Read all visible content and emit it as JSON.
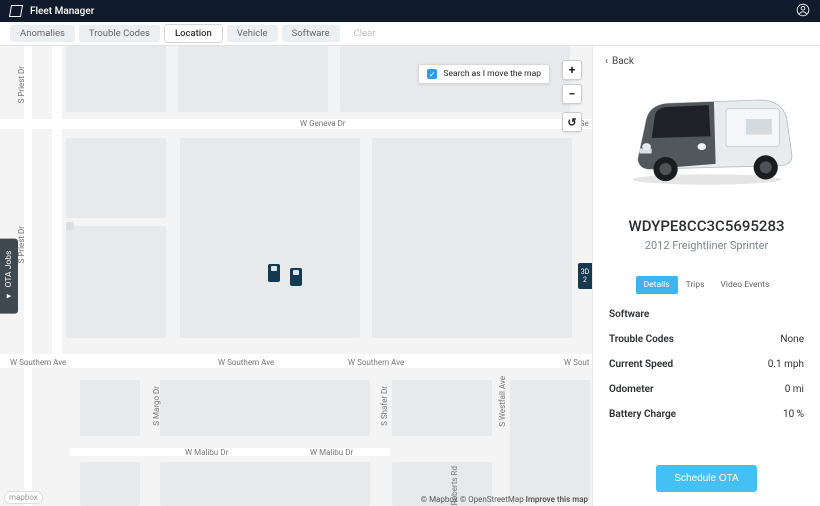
{
  "header": {
    "app_title": "Fleet Manager"
  },
  "tabs": {
    "items": [
      "Anomalies",
      "Trouble Codes",
      "Location",
      "Vehicle",
      "Software"
    ],
    "clear": "Clear"
  },
  "map": {
    "search_checkbox_label": "Search as I move the map",
    "ota_jobs_label": "OTA Jobs",
    "attribution_mapbox": "© Mapbox",
    "attribution_osm": "© OpenStreetMap",
    "attribution_improve": "Improve this map",
    "mapbox_badge": "mapbox",
    "labels": {
      "priest_v1": "S Priest Dr",
      "priest_v2": "S Priest Dr",
      "geneva": "W Geneva Dr",
      "ge": "W Ge",
      "southern1": "W Southern Ave",
      "southern2": "W Southern Ave",
      "southern3": "W Southern Ave",
      "southern4": "W Sout",
      "malibu1": "W Malibu Dr",
      "malibu2": "W Malibu Dr",
      "margo": "S Margo Dr",
      "shafer": "S Shafer Dr",
      "westfall": "S Westfall Ave",
      "roberts": "S Roberts Rd"
    },
    "map3d_1": "3D",
    "map3d_2": "2"
  },
  "detail": {
    "back": "Back",
    "vin": "WDYPE8CC3C5695283",
    "model": "2012 Freightliner Sprinter",
    "subtabs": {
      "details": "Details",
      "trips": "Trips",
      "video": "Video Events"
    },
    "rows": {
      "software": {
        "k": "Software",
        "v": ""
      },
      "trouble": {
        "k": "Trouble Codes",
        "v": "None"
      },
      "speed": {
        "k": "Current Speed",
        "v": "0.1 mph"
      },
      "odo": {
        "k": "Odometer",
        "v": "0 mi"
      },
      "batt": {
        "k": "Battery Charge",
        "v": "10 %"
      }
    },
    "schedule": "Schedule OTA"
  }
}
